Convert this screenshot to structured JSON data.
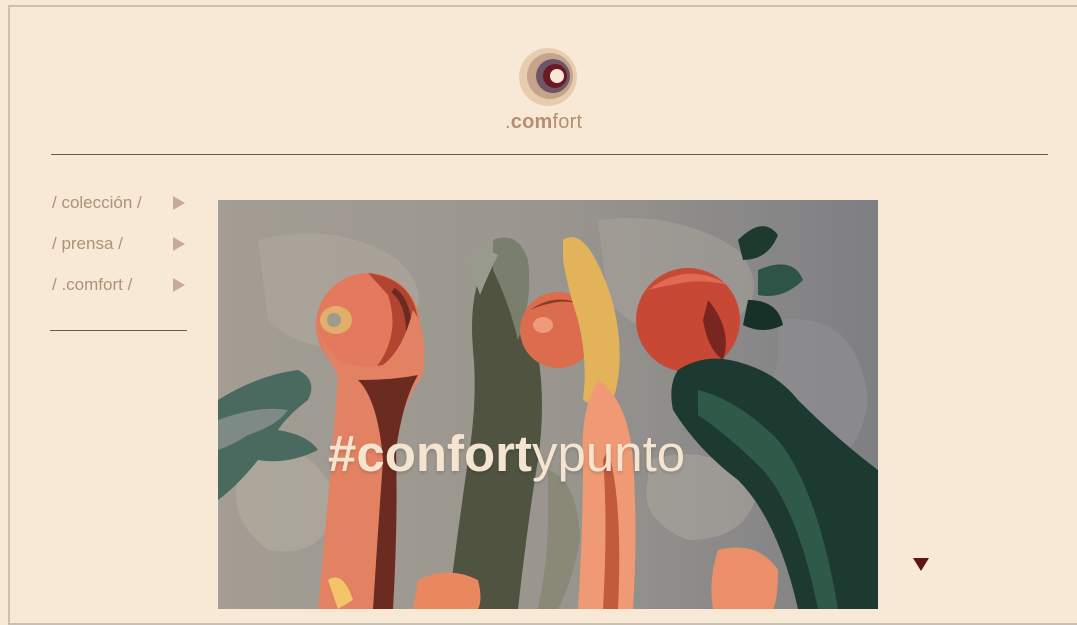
{
  "brand": {
    "logo_prefix": ".",
    "logo_bold": "com",
    "logo_rest": "fort",
    "colors": {
      "background": "#f7e9d5",
      "accent": "#5a1518",
      "nav_text": "#b0907a"
    }
  },
  "nav": {
    "items": [
      {
        "label": "/ colección /",
        "icon": "play-arrow-icon"
      },
      {
        "label": "/ prensa /",
        "icon": "play-arrow-icon"
      },
      {
        "label": "/ .comfort /",
        "icon": "play-arrow-icon"
      }
    ]
  },
  "hero": {
    "hashtag_bold": "#confort",
    "hashtag_light": "ypunto"
  },
  "scroll": {
    "icon": "down-triangle-icon"
  }
}
